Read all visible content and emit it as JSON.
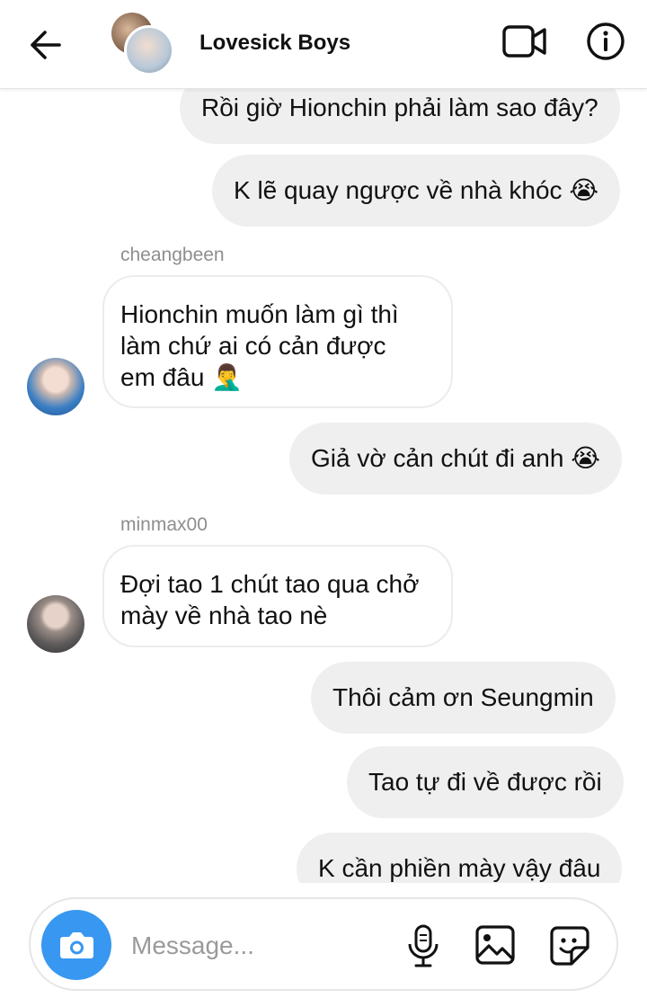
{
  "header": {
    "title": "Lovesick Boys",
    "back_icon": "arrow-left-icon",
    "video_icon": "video-camera-icon",
    "info_icon": "info-icon"
  },
  "messages": [
    {
      "type": "outgoing",
      "text": "Rồi giờ Hionchin phải làm sao đây?"
    },
    {
      "type": "outgoing",
      "text": "K lẽ quay ngược về nhà khóc",
      "emoji": "😭"
    },
    {
      "type": "incoming",
      "sender": "cheangbeen",
      "lines": [
        "Hionchin muốn làm gì thì",
        "làm chứ ai có cản được",
        "em đâu"
      ],
      "emoji": "🤦‍♂️"
    },
    {
      "type": "outgoing",
      "text": "Giả vờ cản chút đi anh",
      "emoji": "😭"
    },
    {
      "type": "incoming",
      "sender": "minmax00",
      "lines": [
        "Đợi tao 1 chút tao qua chở",
        "mày về nhà tao nè"
      ]
    },
    {
      "type": "outgoing",
      "text": "Thôi cảm ơn Seungmin"
    },
    {
      "type": "outgoing",
      "text": "Tao tự đi về được rồi"
    },
    {
      "type": "outgoing",
      "text": "K cần phiền mày vậy đâu"
    }
  ],
  "composer": {
    "placeholder": "Message...",
    "icons": [
      "camera-icon",
      "microphone-icon",
      "gallery-icon",
      "sticker-icon"
    ],
    "accent": "#3897f0"
  },
  "colors": {
    "bubble_out": "#efefef",
    "bubble_in_border": "#ececec",
    "sender": "#8e8e8e"
  }
}
